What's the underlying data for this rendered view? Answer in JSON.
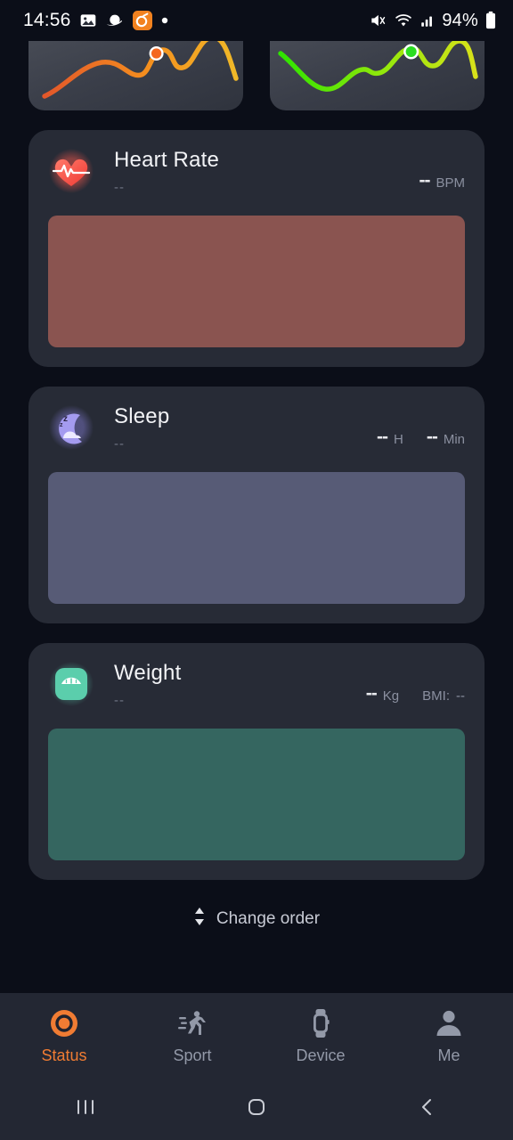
{
  "statusbar": {
    "time": "14:56",
    "battery": "94%",
    "icons": [
      "gallery-icon",
      "planet-icon",
      "camera-app-icon",
      "dot-indicator"
    ],
    "right_icons": [
      "mute-icon",
      "wifi-icon",
      "signal-icon",
      "battery-icon"
    ]
  },
  "mini_cards": [
    {
      "name": "steps-mini-card",
      "line_color": "#f5a623",
      "line_color_start": "#e2572a",
      "dot_color": "#f4671f"
    },
    {
      "name": "calories-mini-card",
      "line_color": "#d7e11a",
      "line_color_start": "#2fe300",
      "dot_color": "#2bdd21"
    }
  ],
  "cards": [
    {
      "key": "heart-rate",
      "title": "Heart Rate",
      "subtitle": "--",
      "icon": "heart-pulse-icon",
      "readout": [
        {
          "value": "--",
          "unit": "BPM"
        }
      ],
      "placeholder_color": "#8a5450"
    },
    {
      "key": "sleep",
      "title": "Sleep",
      "subtitle": "--",
      "icon": "sleeping-moon-icon",
      "readout": [
        {
          "value": "--",
          "unit": "H"
        },
        {
          "value": "--",
          "unit": "Min"
        }
      ],
      "placeholder_color": "#575b76"
    },
    {
      "key": "weight",
      "title": "Weight",
      "subtitle": "--",
      "icon": "weight-scale-icon",
      "readout": [
        {
          "value": "--",
          "unit": "Kg"
        },
        {
          "value": "",
          "unit": "BMI:"
        },
        {
          "value": "",
          "unit": "--"
        }
      ],
      "placeholder_color": "#356660"
    }
  ],
  "change_order": {
    "label": "Change order",
    "icon": "up-down-arrow-icon"
  },
  "bottom_nav": {
    "active_color": "#f07c33",
    "items": [
      {
        "label": "Status",
        "icon": "status-ring-icon",
        "active": true
      },
      {
        "label": "Sport",
        "icon": "running-person-icon",
        "active": false
      },
      {
        "label": "Device",
        "icon": "smartwatch-icon",
        "active": false
      },
      {
        "label": "Me",
        "icon": "person-icon",
        "active": false
      }
    ]
  },
  "system_nav": {
    "items": [
      {
        "name": "recents-button",
        "icon": "three-bars-icon"
      },
      {
        "name": "home-button",
        "icon": "rounded-square-icon"
      },
      {
        "name": "back-button",
        "icon": "chevron-left-icon"
      }
    ]
  }
}
